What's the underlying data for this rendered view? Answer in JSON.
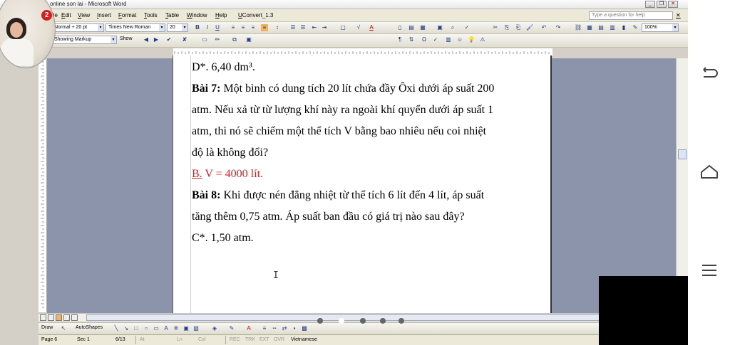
{
  "window": {
    "title": "online son lai - Microsoft Word",
    "help_placeholder": "Type a question for help",
    "badge_count": "2"
  },
  "menu": {
    "items": [
      "File",
      "Edit",
      "View",
      "Insert",
      "Format",
      "Tools",
      "Table",
      "Window",
      "Help",
      "UConvert_1.3"
    ]
  },
  "formatting": {
    "style": "Normal + 20 pt",
    "font": "Times New Roman",
    "size": "20",
    "zoom": "100%"
  },
  "reviewing": {
    "display": "Showing Markup",
    "show": "Show"
  },
  "document": {
    "line1": "D*. 6,40 dm³.",
    "bai7_label": "Bài 7:",
    "bai7_l1": " Một bình có dung tích 20 lít chứa đầy Ôxi dưới áp suất 200",
    "bai7_l2": "atm. Nếu xả từ từ lượng khí này ra ngoài khí quyển dưới áp suất 1",
    "bai7_l3": "atm, thì nó sẽ chiếm một thể tích V bằng bao nhiêu nếu coi nhiệt",
    "bai7_l4": "độ là không đổi?",
    "answer7_letter": "B.",
    "answer7_text": "  V = 4000 lít.",
    "bai8_label": "Bài 8:",
    "bai8_l1": " Khi được nén đẳng nhiệt từ thể tích 6 lít đến 4 lít, áp suất",
    "bai8_l2": "tăng thêm 0,75 atm. Áp suất ban đầu có giá trị nào sau đây?",
    "answer8": "C*. 1,50 atm."
  },
  "drawing": {
    "draw": "Draw",
    "autoshapes": "AutoShapes"
  },
  "status": {
    "page": "Page 6",
    "sec": "Sec 1",
    "count": "6/13",
    "at": "At",
    "ln": "Ln",
    "col": "Col",
    "rec": "REC",
    "trk": "TRK",
    "ext": "EXT",
    "ovr": "OVR",
    "language": "Vietnamese"
  }
}
